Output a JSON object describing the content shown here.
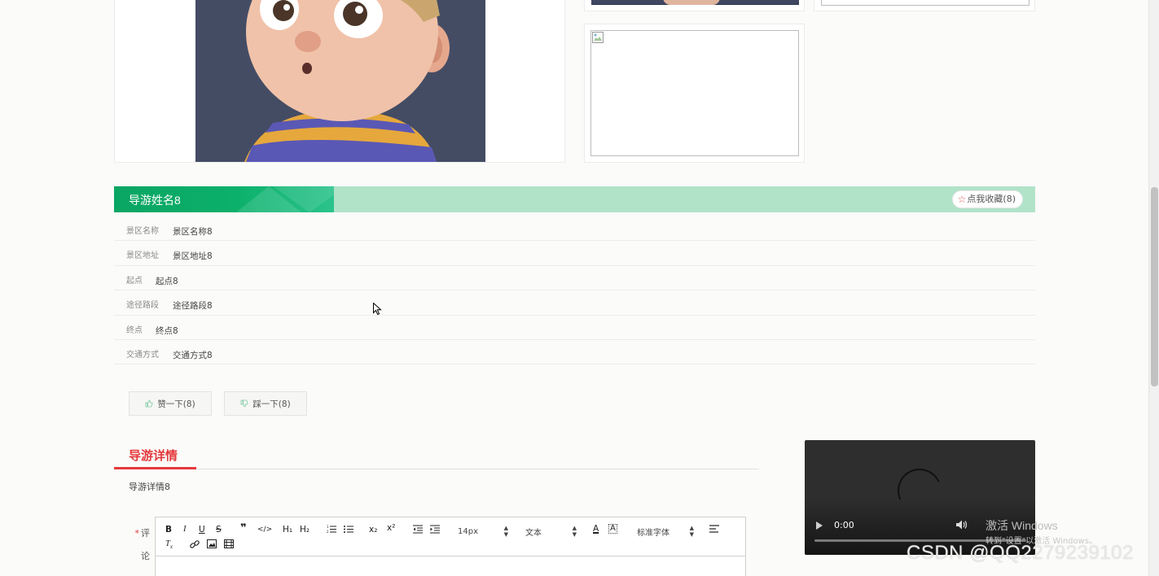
{
  "guide": {
    "name": "导游姓名8",
    "favorite_label": "点我收藏(8)"
  },
  "info": [
    {
      "label": "景区名称",
      "value": "景区名称8"
    },
    {
      "label": "景区地址",
      "value": "景区地址8"
    },
    {
      "label": "起点",
      "value": "起点8"
    },
    {
      "label": "途径路段",
      "value": "途径路段8"
    },
    {
      "label": "终点",
      "value": "终点8"
    },
    {
      "label": "交通方式",
      "value": "交通方式8"
    }
  ],
  "votes": {
    "like_label": "赞一下(8)",
    "dislike_label": "踩一下(8)"
  },
  "detail": {
    "tab_label": "导游详情",
    "content": "导游详情8"
  },
  "comment": {
    "required_mark": "*",
    "label_line1": "评",
    "label_line2": "论",
    "toolbar": {
      "h1": "H₁",
      "h2": "H₂",
      "sub": "x₂",
      "sup": "x²",
      "size": "14px",
      "text_type": "文本",
      "font": "标准字体"
    }
  },
  "video": {
    "time": "0:00"
  },
  "overlays": {
    "win_activate": "激活 Windows",
    "win_activate_sub": "转到\"设置\"以激活 Windows。",
    "csdn": "CSDN @QQ2279239102"
  },
  "colors": {
    "title_green": "#0aa563",
    "title_bar_light": "#b1e3c9",
    "accent_red": "#e4393c"
  }
}
